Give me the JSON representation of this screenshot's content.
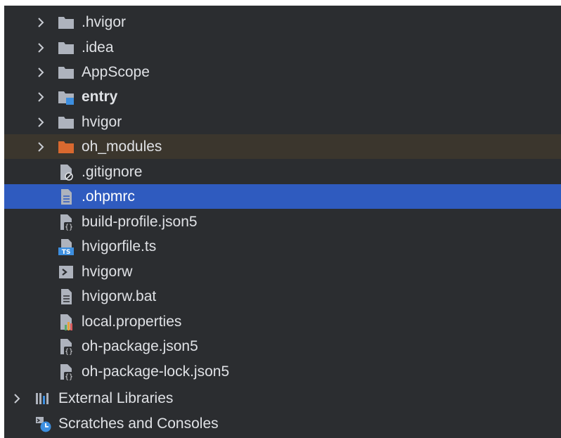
{
  "tree": {
    "items": [
      {
        "label": ".hvigor",
        "icon": "folder-icon"
      },
      {
        "label": ".idea",
        "icon": "folder-icon"
      },
      {
        "label": "AppScope",
        "icon": "folder-icon"
      },
      {
        "label": "entry",
        "icon": "module-folder-icon"
      },
      {
        "label": "hvigor",
        "icon": "folder-icon"
      },
      {
        "label": "oh_modules",
        "icon": "excluded-folder-icon"
      },
      {
        "label": ".gitignore",
        "icon": "ignore-file-icon"
      },
      {
        "label": ".ohpmrc",
        "icon": "text-file-icon"
      },
      {
        "label": "build-profile.json5",
        "icon": "json-file-icon"
      },
      {
        "label": "hvigorfile.ts",
        "icon": "typescript-file-icon"
      },
      {
        "label": "hvigorw",
        "icon": "shell-script-icon"
      },
      {
        "label": "hvigorw.bat",
        "icon": "text-file-icon"
      },
      {
        "label": "local.properties",
        "icon": "properties-file-icon"
      },
      {
        "label": "oh-package.json5",
        "icon": "json-file-icon"
      },
      {
        "label": "oh-package-lock.json5",
        "icon": "json-file-icon"
      },
      {
        "label": "External Libraries",
        "icon": "libraries-icon"
      },
      {
        "label": "Scratches and Consoles",
        "icon": "scratches-icon"
      }
    ]
  },
  "colors": {
    "background": "#2b2d30",
    "selection": "#2f5bbf",
    "excluded_row": "#3b362d",
    "text": "#dfe1e5",
    "folder": "#aeb3bd",
    "excluded_folder": "#d9692f",
    "module_badge": "#3d8fe0"
  }
}
